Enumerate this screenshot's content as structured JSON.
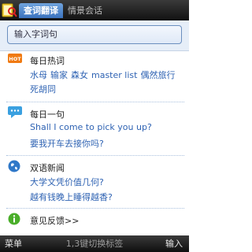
{
  "tabs": [
    {
      "label": "查词翻译",
      "active": true
    },
    {
      "label": "情景会话",
      "active": false
    }
  ],
  "search": {
    "placeholder": "输入字词句"
  },
  "sections": {
    "hot_words": {
      "icon": "hot-icon",
      "badge": "HOT",
      "title": "每日热词",
      "words": [
        "水母",
        "输家",
        "森女",
        "master list",
        "偶然旅行",
        "死胡同"
      ]
    },
    "daily_sentence": {
      "icon": "chat-bubble-icon",
      "title": "每日一句",
      "en": "Shall I come to pick you up?",
      "zh": "要我开车去接你吗?"
    },
    "bilingual_news": {
      "icon": "globe-icon",
      "title": "双语新闻",
      "items": [
        "大学文凭价值几何?",
        "越有钱晚上睡得越香?"
      ]
    },
    "feedback": {
      "icon": "info-icon",
      "label": "意见反馈>>"
    }
  },
  "bottom_bar": {
    "left": "菜单",
    "center": "1,3键切换标签",
    "right": "输入"
  },
  "colors": {
    "accent": "#3b73bf",
    "link": "#2f63b3",
    "bar": "#111111"
  }
}
